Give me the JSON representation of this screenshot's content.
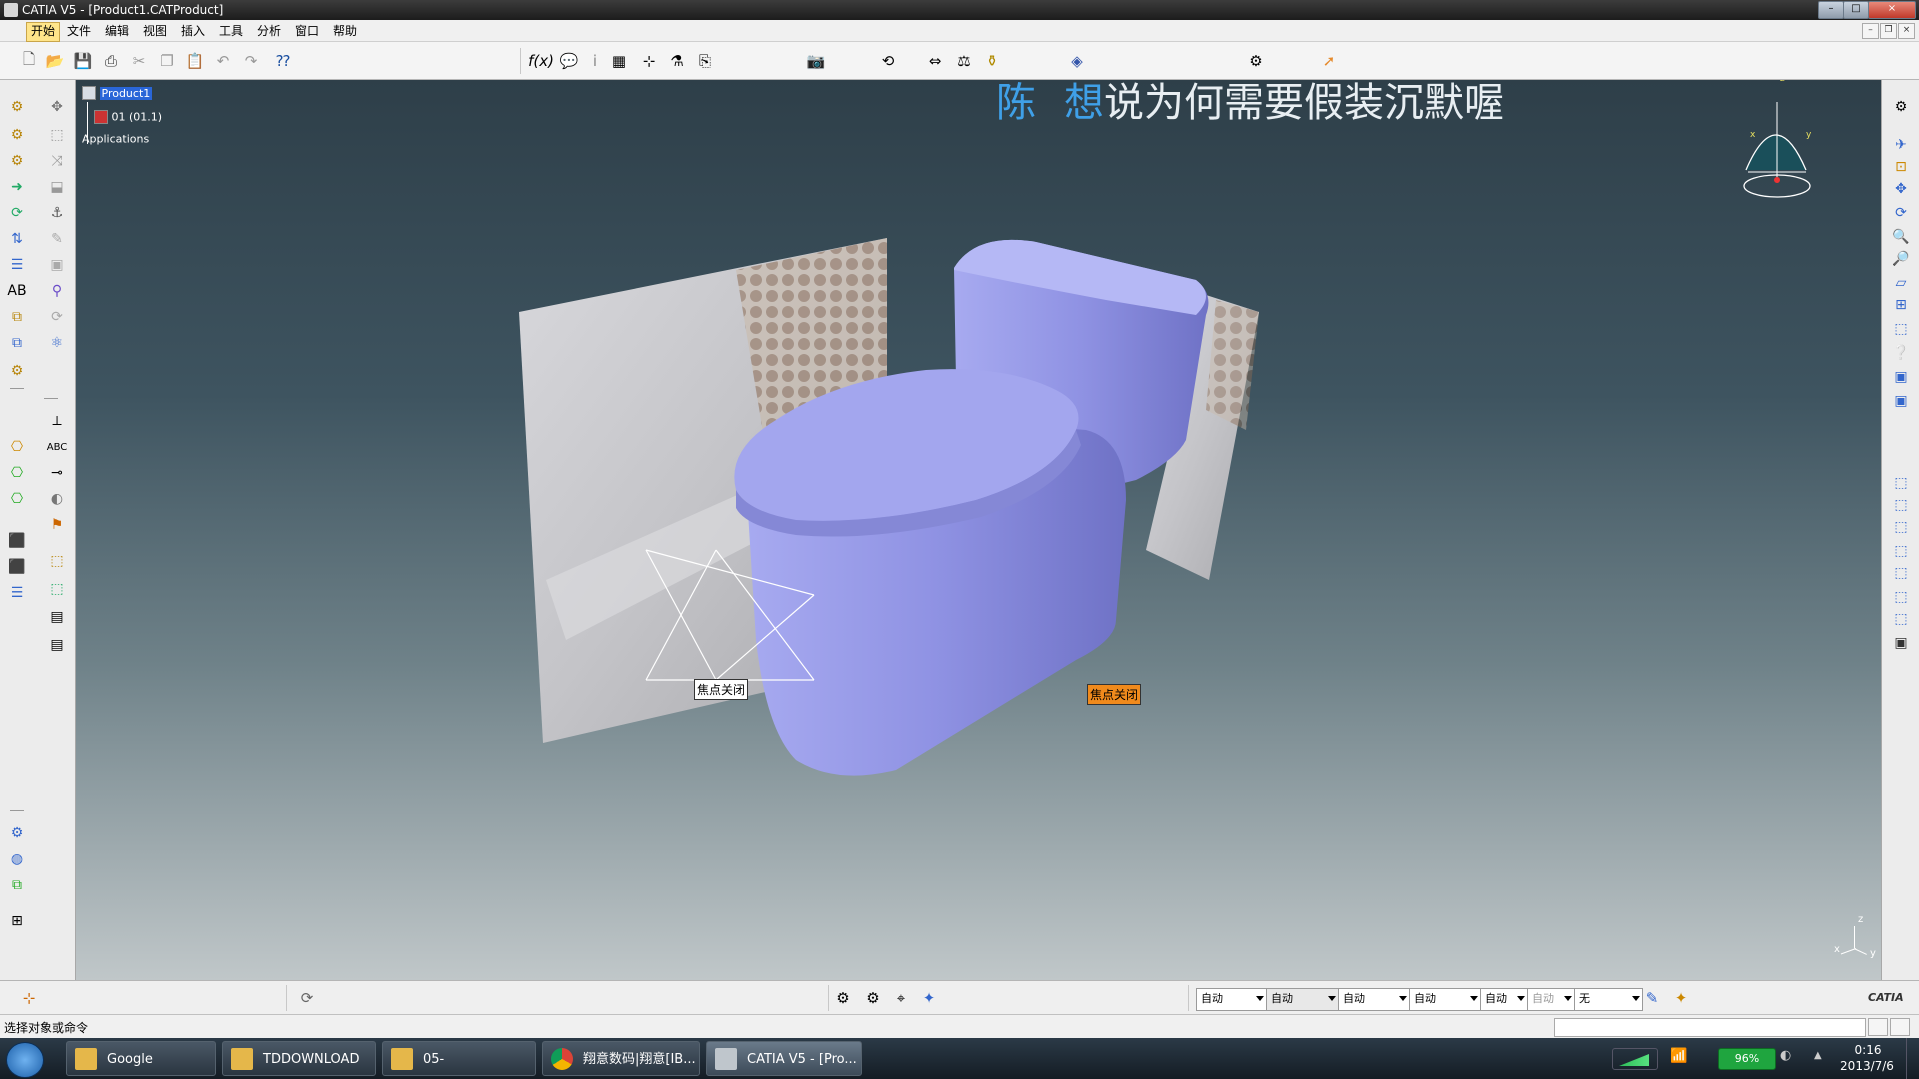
{
  "window": {
    "title": "CATIA V5 - [Product1.CATProduct]",
    "min": "–",
    "max": "□",
    "close": "×"
  },
  "menu": {
    "items": [
      "开始",
      "文件",
      "编辑",
      "视图",
      "插入",
      "工具",
      "分析",
      "窗口",
      "帮助"
    ]
  },
  "tree": {
    "root": "Product1",
    "child": "01 (01.1)",
    "applications": "Applications"
  },
  "overlay": {
    "name1": "陈",
    "name2": "想",
    "rest": "说为何需要假装沉默喔"
  },
  "tags": {
    "left": "焦点关闭",
    "right": "焦点关闭"
  },
  "compass": {
    "x": "x",
    "y": "y",
    "z": "z"
  },
  "axes": {
    "x": "x",
    "y": "y",
    "z": "z"
  },
  "bottom": {
    "combos": [
      "自动",
      "自动",
      "自动",
      "自动",
      "自动",
      "自动",
      "无"
    ]
  },
  "status": {
    "prompt": "选择对象或命令"
  },
  "taskbar": {
    "items": [
      "Google",
      "TDDOWNLOAD",
      "05-",
      "翔意数码|翔意[IB...",
      "CATIA V5 - [Pro..."
    ],
    "battery": "96%",
    "time": "0:16",
    "date": "2013/7/6"
  },
  "brand": {
    "logo": "CATIA"
  },
  "colors": {
    "model": "#8f92e3",
    "overlay_blue": "#3fa0e8",
    "tag_orange": "#f08a1c",
    "title_bar": "#2a2a2a"
  }
}
